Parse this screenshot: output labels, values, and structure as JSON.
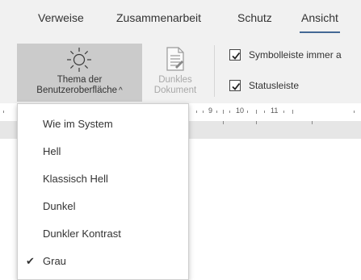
{
  "tabs": [
    {
      "label": "Verweise",
      "active": false
    },
    {
      "label": "Zusammenarbeit",
      "active": false
    },
    {
      "label": "Schutz",
      "active": false
    },
    {
      "label": "Ansicht",
      "active": true
    }
  ],
  "ribbon": {
    "theme_button": {
      "line1": "Thema der",
      "line2": "Benutzeroberfläche",
      "caret": "^",
      "icon": "sun-icon"
    },
    "dark_document_button": {
      "line1": "Dunkles",
      "line2": "Dokument",
      "icon": "document-icon",
      "enabled": false
    },
    "checkboxes": [
      {
        "label": "Symbolleiste immer a",
        "checked": true
      },
      {
        "label": "Statusleiste",
        "checked": true
      }
    ]
  },
  "ruler": {
    "labels": [
      "9",
      "10",
      "11"
    ]
  },
  "theme_menu": {
    "items": [
      {
        "label": "Wie im System",
        "checked": false
      },
      {
        "label": "Hell",
        "checked": false
      },
      {
        "label": "Klassisch Hell",
        "checked": false
      },
      {
        "label": "Dunkel",
        "checked": false
      },
      {
        "label": "Dunkler Kontrast",
        "checked": false
      },
      {
        "label": "Grau",
        "checked": true
      }
    ],
    "check_glyph": "✔"
  },
  "colors": {
    "tab_underline": "#446995",
    "ribbon_bg": "#f1f1f1",
    "pressed_button_bg": "#cbcbcb",
    "disabled_text": "#a8a8a8"
  }
}
